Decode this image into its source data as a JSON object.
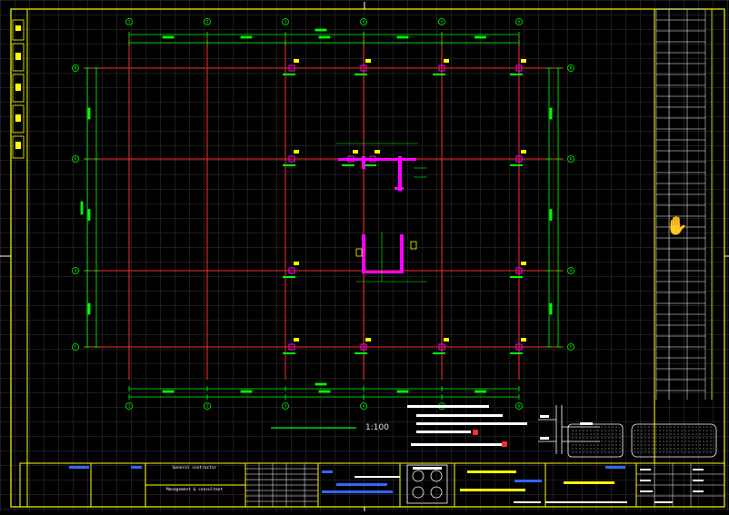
{
  "drawing": {
    "scale": "1:100",
    "grid_x": [
      "1",
      "2",
      "3",
      "4",
      "5",
      "6"
    ],
    "grid_y": [
      "N",
      "K",
      "H",
      "F"
    ],
    "colors": {
      "grid": "#ff2a2a",
      "dimension": "#00ff00",
      "border": "#ffff00",
      "column": "#ff00ff",
      "label": "#ffff00",
      "background": "#000000"
    }
  },
  "title_block": {
    "general_contractor": "General contractor",
    "project_label": "Management & consultant"
  },
  "icons": {
    "pan": "hand-pan-icon"
  }
}
